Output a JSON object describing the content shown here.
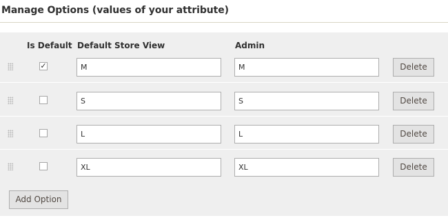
{
  "section_title": "Manage Options (values of your attribute)",
  "headers": {
    "is_default": "Is Default",
    "default_store_view": "Default Store View",
    "admin": "Admin"
  },
  "options": [
    {
      "is_default": true,
      "is_default_mark": "✓",
      "store_view": "M",
      "admin": "M",
      "delete_label": "Delete"
    },
    {
      "is_default": false,
      "is_default_mark": "",
      "store_view": "S",
      "admin": "S",
      "delete_label": "Delete"
    },
    {
      "is_default": false,
      "is_default_mark": "",
      "store_view": "L",
      "admin": "L",
      "delete_label": "Delete"
    },
    {
      "is_default": false,
      "is_default_mark": "",
      "store_view": "XL",
      "admin": "XL",
      "delete_label": "Delete"
    }
  ],
  "add_option_label": "Add Option",
  "icons": {
    "drag_handle": "drag-handle-icon",
    "checkmark": "checkmark-icon"
  },
  "colors": {
    "panel_bg": "#efefef",
    "button_bg": "#e3e3e3",
    "text": "#303030"
  }
}
